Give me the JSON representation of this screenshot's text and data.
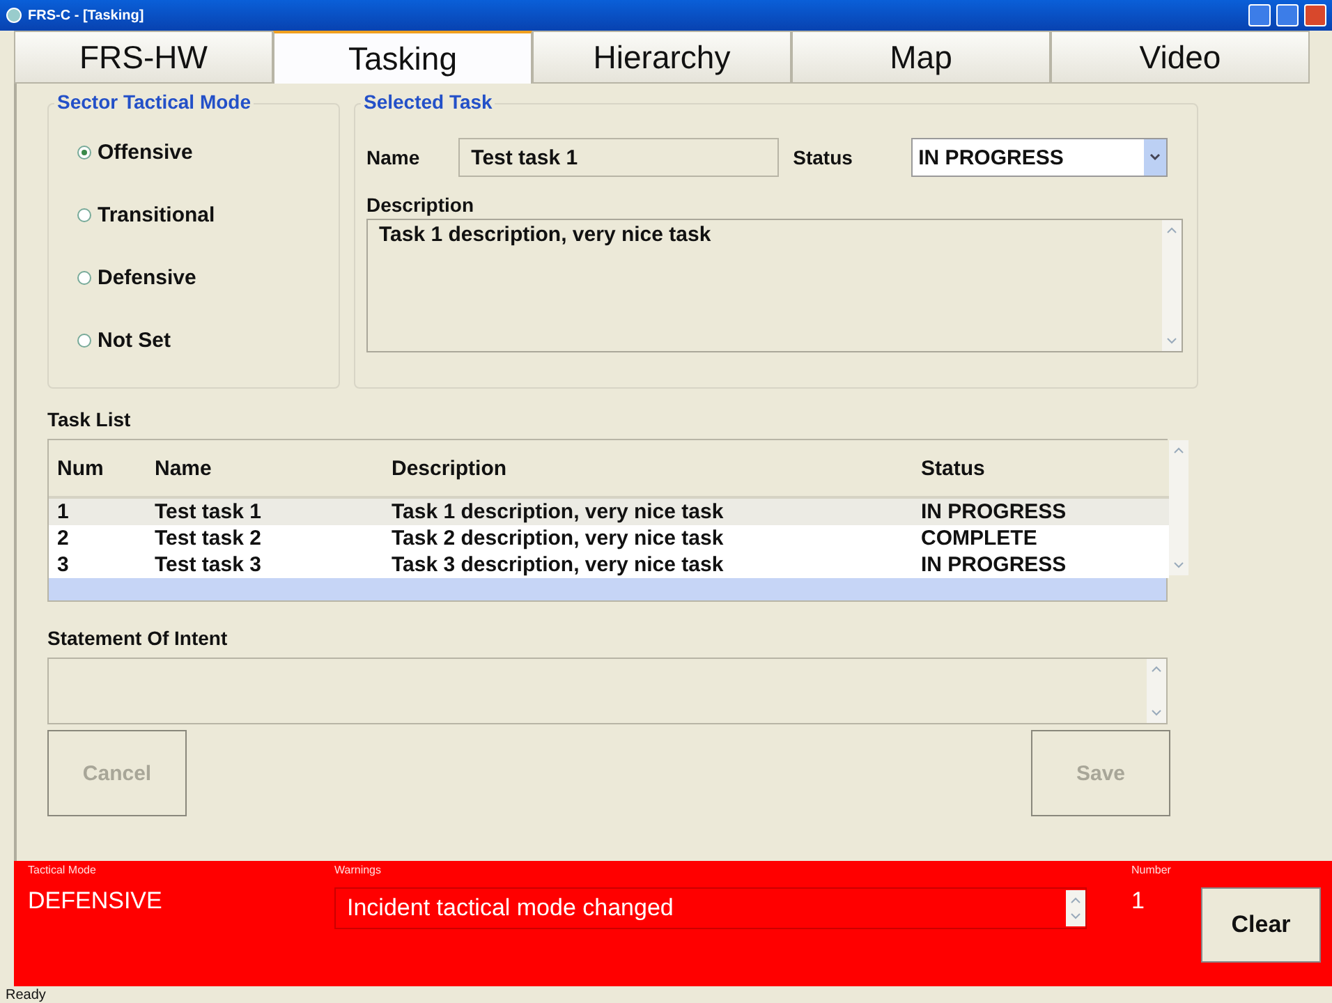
{
  "window": {
    "title": "FRS-C - [Tasking]"
  },
  "tabs": [
    {
      "label": "FRS-HW",
      "selected": false
    },
    {
      "label": "Tasking",
      "selected": true
    },
    {
      "label": "Hierarchy",
      "selected": false
    },
    {
      "label": "Map",
      "selected": false
    },
    {
      "label": "Video",
      "selected": false
    }
  ],
  "sector_tactical_mode": {
    "title": "Sector Tactical Mode",
    "options": [
      {
        "label": "Offensive",
        "selected": true
      },
      {
        "label": "Transitional",
        "selected": false
      },
      {
        "label": "Defensive",
        "selected": false
      },
      {
        "label": "Not Set",
        "selected": false
      }
    ]
  },
  "selected_task": {
    "title": "Selected Task",
    "name_label": "Name",
    "name": "Test task 1",
    "status_label": "Status",
    "status": "IN PROGRESS",
    "description_label": "Description",
    "description": "Task 1 description, very nice task"
  },
  "task_list": {
    "title": "Task List",
    "columns": [
      "Num",
      "Name",
      "Description",
      "Status"
    ],
    "rows": [
      {
        "cells": [
          "1",
          "Test task 1",
          "Task 1 description, very nice task",
          "IN PROGRESS"
        ],
        "selected": true
      },
      {
        "cells": [
          "2",
          "Test task 2",
          "Task 2 description, very nice task",
          "COMPLETE"
        ],
        "selected": false
      },
      {
        "cells": [
          "3",
          "Test task 3",
          "Task 3 description, very nice task",
          "IN PROGRESS"
        ],
        "selected": false
      }
    ]
  },
  "statement_of_intent": {
    "label": "Statement Of Intent"
  },
  "buttons": [
    {
      "label": "Cancel",
      "disabled": true
    },
    {
      "label": "Save",
      "disabled": true
    }
  ],
  "alert_bar": {
    "tactical_mode_label": "Tactical Mode",
    "tactical_mode": "DEFENSIVE",
    "warnings_label": "Warnings",
    "warning": "Incident tactical mode changed",
    "number_label": "Number",
    "number": "1",
    "clear": "Clear"
  },
  "status_bar": "Ready"
}
